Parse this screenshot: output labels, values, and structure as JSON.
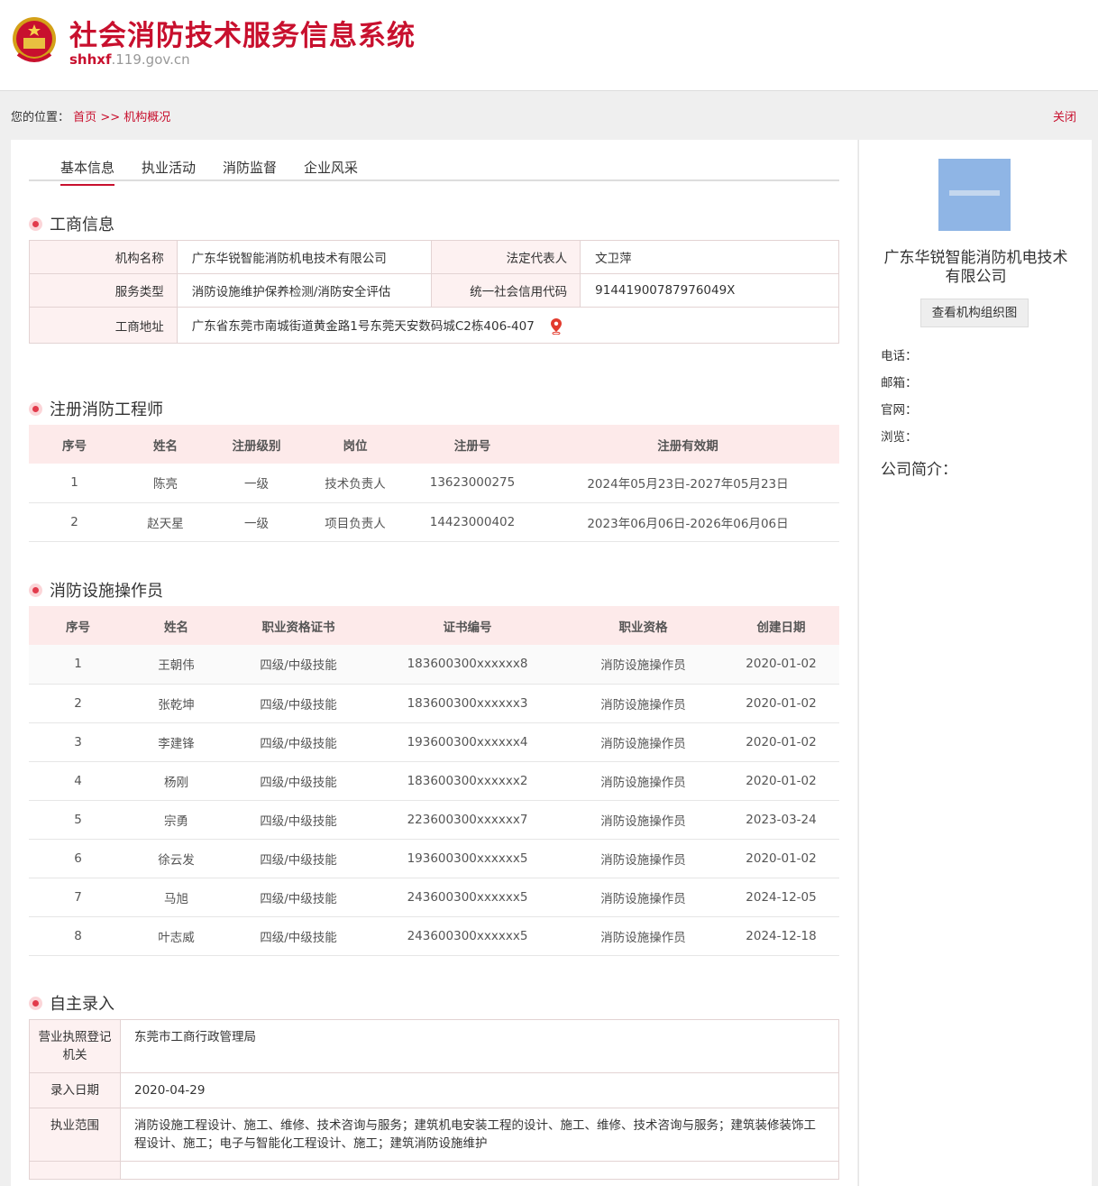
{
  "header": {
    "title": "社会消防技术服务信息系统",
    "domain_prefix": "shhxf",
    "domain_suffix": ".119.gov.cn"
  },
  "breadcrumb": {
    "label": "您的位置：",
    "home": "首页",
    "sep": ">>",
    "current": "机构概况",
    "close": "关闭"
  },
  "tabs": [
    "基本信息",
    "执业活动",
    "消防监督",
    "企业风采"
  ],
  "business": {
    "title": "工商信息",
    "name_label": "机构名称",
    "name": "广东华锐智能消防机电技术有限公司",
    "rep_label": "法定代表人",
    "rep": "文卫萍",
    "type_label": "服务类型",
    "type": "消防设施维护保养检测/消防安全评估",
    "credit_label": "统一社会信用代码",
    "credit": "91441900787976049X",
    "address_label": "工商地址",
    "address": "广东省东莞市南城街道黄金路1号东莞天安数码城C2栋406-407"
  },
  "engineers": {
    "title": "注册消防工程师",
    "headers": [
      "序号",
      "姓名",
      "注册级别",
      "岗位",
      "注册号",
      "注册有效期"
    ],
    "rows": [
      [
        "1",
        "陈亮",
        "一级",
        "技术负责人",
        "13623000275",
        "2024年05月23日-2027年05月23日"
      ],
      [
        "2",
        "赵天星",
        "一级",
        "项目负责人",
        "14423000402",
        "2023年06月06日-2026年06月06日"
      ]
    ]
  },
  "operators": {
    "title": "消防设施操作员",
    "headers": [
      "序号",
      "姓名",
      "职业资格证书",
      "证书编号",
      "职业资格",
      "创建日期"
    ],
    "rows": [
      [
        "1",
        "王朝伟",
        "四级/中级技能",
        "183600300xxxxxx8",
        "消防设施操作员",
        "2020-01-02"
      ],
      [
        "2",
        "张乾坤",
        "四级/中级技能",
        "183600300xxxxxx3",
        "消防设施操作员",
        "2020-01-02"
      ],
      [
        "3",
        "李建锋",
        "四级/中级技能",
        "193600300xxxxxx4",
        "消防设施操作员",
        "2020-01-02"
      ],
      [
        "4",
        "杨刚",
        "四级/中级技能",
        "183600300xxxxxx2",
        "消防设施操作员",
        "2020-01-02"
      ],
      [
        "5",
        "宗勇",
        "四级/中级技能",
        "223600300xxxxxx7",
        "消防设施操作员",
        "2023-03-24"
      ],
      [
        "6",
        "徐云发",
        "四级/中级技能",
        "193600300xxxxxx5",
        "消防设施操作员",
        "2020-01-02"
      ],
      [
        "7",
        "马旭",
        "四级/中级技能",
        "243600300xxxxxx5",
        "消防设施操作员",
        "2024-12-05"
      ],
      [
        "8",
        "叶志威",
        "四级/中级技能",
        "243600300xxxxxx5",
        "消防设施操作员",
        "2024-12-18"
      ]
    ]
  },
  "self_entry": {
    "title": "自主录入",
    "authority_label": "营业执照登记机关",
    "authority": "东莞市工商行政管理局",
    "date_label": "录入日期",
    "date": "2020-04-29",
    "scope_label": "执业范围",
    "scope": "消防设施工程设计、施工、维修、技术咨询与服务；建筑机电安装工程的设计、施工、维修、技术咨询与服务；建筑装修装饰工程设计、施工；电子与智能化工程设计、施工；建筑消防设施维护"
  },
  "sidebar": {
    "company": "广东华锐智能消防机电技术有限公司",
    "org_button": "查看机构组织图",
    "phone_label": "电话：",
    "email_label": "邮箱：",
    "website_label": "官网：",
    "views_label": "浏览：",
    "intro_label": "公司简介："
  },
  "colors": {
    "brand": "#c8102e",
    "label_bg": "#fdf1f1",
    "header_bg": "#fdeaea",
    "logo_bg": "#8fb5e5"
  }
}
